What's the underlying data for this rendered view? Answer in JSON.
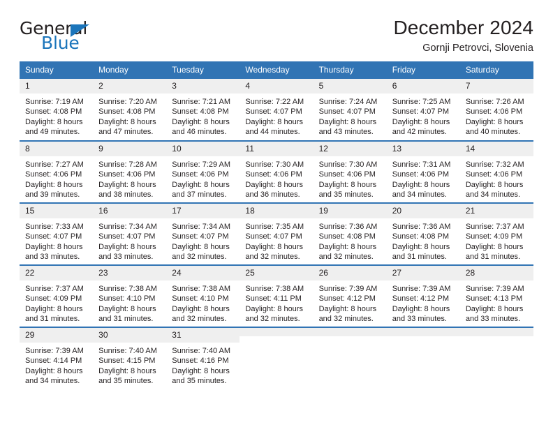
{
  "brand": {
    "name_top": "General",
    "name_bottom": "Blue",
    "triangle_color": "#1b75bb"
  },
  "header": {
    "title": "December 2024",
    "subtitle": "Gornji Petrovci, Slovenia"
  },
  "theme": {
    "header_blue": "#3174b4",
    "daynum_bg": "#efefef",
    "text": "#231f20"
  },
  "weekday_headers": [
    "Sunday",
    "Monday",
    "Tuesday",
    "Wednesday",
    "Thursday",
    "Friday",
    "Saturday"
  ],
  "weeks": [
    [
      {
        "day": "1",
        "sunrise": "Sunrise: 7:19 AM",
        "sunset": "Sunset: 4:08 PM",
        "daylight1": "Daylight: 8 hours",
        "daylight2": "and 49 minutes."
      },
      {
        "day": "2",
        "sunrise": "Sunrise: 7:20 AM",
        "sunset": "Sunset: 4:08 PM",
        "daylight1": "Daylight: 8 hours",
        "daylight2": "and 47 minutes."
      },
      {
        "day": "3",
        "sunrise": "Sunrise: 7:21 AM",
        "sunset": "Sunset: 4:08 PM",
        "daylight1": "Daylight: 8 hours",
        "daylight2": "and 46 minutes."
      },
      {
        "day": "4",
        "sunrise": "Sunrise: 7:22 AM",
        "sunset": "Sunset: 4:07 PM",
        "daylight1": "Daylight: 8 hours",
        "daylight2": "and 44 minutes."
      },
      {
        "day": "5",
        "sunrise": "Sunrise: 7:24 AM",
        "sunset": "Sunset: 4:07 PM",
        "daylight1": "Daylight: 8 hours",
        "daylight2": "and 43 minutes."
      },
      {
        "day": "6",
        "sunrise": "Sunrise: 7:25 AM",
        "sunset": "Sunset: 4:07 PM",
        "daylight1": "Daylight: 8 hours",
        "daylight2": "and 42 minutes."
      },
      {
        "day": "7",
        "sunrise": "Sunrise: 7:26 AM",
        "sunset": "Sunset: 4:06 PM",
        "daylight1": "Daylight: 8 hours",
        "daylight2": "and 40 minutes."
      }
    ],
    [
      {
        "day": "8",
        "sunrise": "Sunrise: 7:27 AM",
        "sunset": "Sunset: 4:06 PM",
        "daylight1": "Daylight: 8 hours",
        "daylight2": "and 39 minutes."
      },
      {
        "day": "9",
        "sunrise": "Sunrise: 7:28 AM",
        "sunset": "Sunset: 4:06 PM",
        "daylight1": "Daylight: 8 hours",
        "daylight2": "and 38 minutes."
      },
      {
        "day": "10",
        "sunrise": "Sunrise: 7:29 AM",
        "sunset": "Sunset: 4:06 PM",
        "daylight1": "Daylight: 8 hours",
        "daylight2": "and 37 minutes."
      },
      {
        "day": "11",
        "sunrise": "Sunrise: 7:30 AM",
        "sunset": "Sunset: 4:06 PM",
        "daylight1": "Daylight: 8 hours",
        "daylight2": "and 36 minutes."
      },
      {
        "day": "12",
        "sunrise": "Sunrise: 7:30 AM",
        "sunset": "Sunset: 4:06 PM",
        "daylight1": "Daylight: 8 hours",
        "daylight2": "and 35 minutes."
      },
      {
        "day": "13",
        "sunrise": "Sunrise: 7:31 AM",
        "sunset": "Sunset: 4:06 PM",
        "daylight1": "Daylight: 8 hours",
        "daylight2": "and 34 minutes."
      },
      {
        "day": "14",
        "sunrise": "Sunrise: 7:32 AM",
        "sunset": "Sunset: 4:06 PM",
        "daylight1": "Daylight: 8 hours",
        "daylight2": "and 34 minutes."
      }
    ],
    [
      {
        "day": "15",
        "sunrise": "Sunrise: 7:33 AM",
        "sunset": "Sunset: 4:07 PM",
        "daylight1": "Daylight: 8 hours",
        "daylight2": "and 33 minutes."
      },
      {
        "day": "16",
        "sunrise": "Sunrise: 7:34 AM",
        "sunset": "Sunset: 4:07 PM",
        "daylight1": "Daylight: 8 hours",
        "daylight2": "and 33 minutes."
      },
      {
        "day": "17",
        "sunrise": "Sunrise: 7:34 AM",
        "sunset": "Sunset: 4:07 PM",
        "daylight1": "Daylight: 8 hours",
        "daylight2": "and 32 minutes."
      },
      {
        "day": "18",
        "sunrise": "Sunrise: 7:35 AM",
        "sunset": "Sunset: 4:07 PM",
        "daylight1": "Daylight: 8 hours",
        "daylight2": "and 32 minutes."
      },
      {
        "day": "19",
        "sunrise": "Sunrise: 7:36 AM",
        "sunset": "Sunset: 4:08 PM",
        "daylight1": "Daylight: 8 hours",
        "daylight2": "and 32 minutes."
      },
      {
        "day": "20",
        "sunrise": "Sunrise: 7:36 AM",
        "sunset": "Sunset: 4:08 PM",
        "daylight1": "Daylight: 8 hours",
        "daylight2": "and 31 minutes."
      },
      {
        "day": "21",
        "sunrise": "Sunrise: 7:37 AM",
        "sunset": "Sunset: 4:09 PM",
        "daylight1": "Daylight: 8 hours",
        "daylight2": "and 31 minutes."
      }
    ],
    [
      {
        "day": "22",
        "sunrise": "Sunrise: 7:37 AM",
        "sunset": "Sunset: 4:09 PM",
        "daylight1": "Daylight: 8 hours",
        "daylight2": "and 31 minutes."
      },
      {
        "day": "23",
        "sunrise": "Sunrise: 7:38 AM",
        "sunset": "Sunset: 4:10 PM",
        "daylight1": "Daylight: 8 hours",
        "daylight2": "and 31 minutes."
      },
      {
        "day": "24",
        "sunrise": "Sunrise: 7:38 AM",
        "sunset": "Sunset: 4:10 PM",
        "daylight1": "Daylight: 8 hours",
        "daylight2": "and 32 minutes."
      },
      {
        "day": "25",
        "sunrise": "Sunrise: 7:38 AM",
        "sunset": "Sunset: 4:11 PM",
        "daylight1": "Daylight: 8 hours",
        "daylight2": "and 32 minutes."
      },
      {
        "day": "26",
        "sunrise": "Sunrise: 7:39 AM",
        "sunset": "Sunset: 4:12 PM",
        "daylight1": "Daylight: 8 hours",
        "daylight2": "and 32 minutes."
      },
      {
        "day": "27",
        "sunrise": "Sunrise: 7:39 AM",
        "sunset": "Sunset: 4:12 PM",
        "daylight1": "Daylight: 8 hours",
        "daylight2": "and 33 minutes."
      },
      {
        "day": "28",
        "sunrise": "Sunrise: 7:39 AM",
        "sunset": "Sunset: 4:13 PM",
        "daylight1": "Daylight: 8 hours",
        "daylight2": "and 33 minutes."
      }
    ],
    [
      {
        "day": "29",
        "sunrise": "Sunrise: 7:39 AM",
        "sunset": "Sunset: 4:14 PM",
        "daylight1": "Daylight: 8 hours",
        "daylight2": "and 34 minutes."
      },
      {
        "day": "30",
        "sunrise": "Sunrise: 7:40 AM",
        "sunset": "Sunset: 4:15 PM",
        "daylight1": "Daylight: 8 hours",
        "daylight2": "and 35 minutes."
      },
      {
        "day": "31",
        "sunrise": "Sunrise: 7:40 AM",
        "sunset": "Sunset: 4:16 PM",
        "daylight1": "Daylight: 8 hours",
        "daylight2": "and 35 minutes."
      },
      {
        "day": "",
        "sunrise": "",
        "sunset": "",
        "daylight1": "",
        "daylight2": ""
      },
      {
        "day": "",
        "sunrise": "",
        "sunset": "",
        "daylight1": "",
        "daylight2": ""
      },
      {
        "day": "",
        "sunrise": "",
        "sunset": "",
        "daylight1": "",
        "daylight2": ""
      },
      {
        "day": "",
        "sunrise": "",
        "sunset": "",
        "daylight1": "",
        "daylight2": ""
      }
    ]
  ]
}
